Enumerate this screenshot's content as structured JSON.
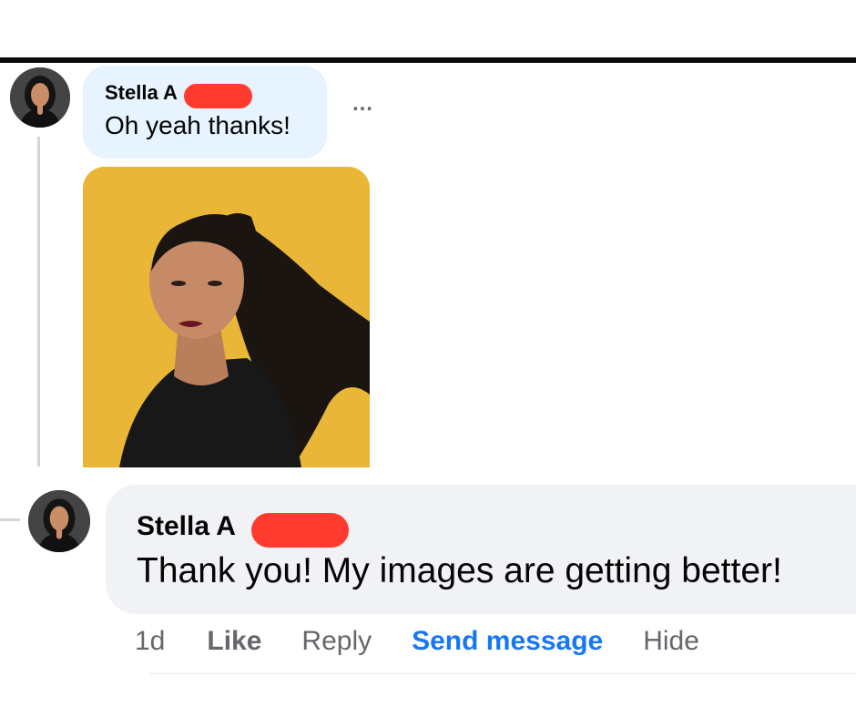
{
  "comment": {
    "author": "Stella A",
    "text": "Oh yeah thanks!",
    "more_icon": "…",
    "author_redacted": true,
    "attachment": "portrait-photo"
  },
  "reply": {
    "author": "Stella A",
    "text": "Thank you! My images are getting better!",
    "author_redacted": true,
    "actions": {
      "time": "1d",
      "like": "Like",
      "reply": "Reply",
      "send_message": "Send message",
      "hide": "Hide"
    }
  },
  "colors": {
    "comment_bubble": "#e7f3ff",
    "reply_bubble": "#f0f2f5",
    "redaction": "#ff3b30",
    "link_blue": "#1877f2",
    "muted_text": "#65676b",
    "photo_background": "#e9b637"
  }
}
